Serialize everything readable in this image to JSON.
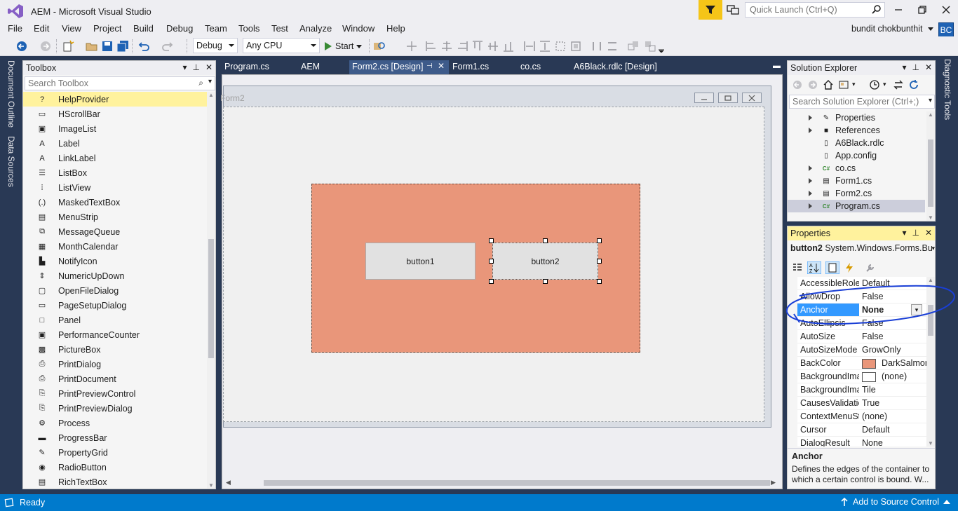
{
  "window": {
    "title": "AEM - Microsoft Visual Studio",
    "quick_launch_placeholder": "Quick Launch (Ctrl+Q)",
    "user_name": "bundit chokbunthit",
    "user_initials": "BC"
  },
  "menu": [
    "File",
    "Edit",
    "View",
    "Project",
    "Build",
    "Debug",
    "Team",
    "Tools",
    "Test",
    "Analyze",
    "Window",
    "Help"
  ],
  "toolbar": {
    "config": "Debug",
    "platform": "Any CPU",
    "start_label": "Start"
  },
  "left_tabs": [
    "Document Outline",
    "Data Sources"
  ],
  "right_tabs": [
    "Diagnostic Tools"
  ],
  "toolbox": {
    "title": "Toolbox",
    "search_placeholder": "Search Toolbox",
    "items": [
      {
        "label": "HelpProvider",
        "icon": "?",
        "selected": true
      },
      {
        "label": "HScrollBar",
        "icon": "▭"
      },
      {
        "label": "ImageList",
        "icon": "▣"
      },
      {
        "label": "Label",
        "icon": "A"
      },
      {
        "label": "LinkLabel",
        "icon": "A"
      },
      {
        "label": "ListBox",
        "icon": "☰"
      },
      {
        "label": "ListView",
        "icon": "⁞"
      },
      {
        "label": "MaskedTextBox",
        "icon": "(.)"
      },
      {
        "label": "MenuStrip",
        "icon": "▤"
      },
      {
        "label": "MessageQueue",
        "icon": "⧉"
      },
      {
        "label": "MonthCalendar",
        "icon": "▦"
      },
      {
        "label": "NotifyIcon",
        "icon": "▙"
      },
      {
        "label": "NumericUpDown",
        "icon": "⇕"
      },
      {
        "label": "OpenFileDialog",
        "icon": "▢"
      },
      {
        "label": "PageSetupDialog",
        "icon": "▭"
      },
      {
        "label": "Panel",
        "icon": "□"
      },
      {
        "label": "PerformanceCounter",
        "icon": "▣"
      },
      {
        "label": "PictureBox",
        "icon": "▩"
      },
      {
        "label": "PrintDialog",
        "icon": "⎙"
      },
      {
        "label": "PrintDocument",
        "icon": "⎙"
      },
      {
        "label": "PrintPreviewControl",
        "icon": "⎘"
      },
      {
        "label": "PrintPreviewDialog",
        "icon": "⎘"
      },
      {
        "label": "Process",
        "icon": "⚙"
      },
      {
        "label": "ProgressBar",
        "icon": "▬"
      },
      {
        "label": "PropertyGrid",
        "icon": "✎"
      },
      {
        "label": "RadioButton",
        "icon": "◉"
      },
      {
        "label": "RichTextBox",
        "icon": "▤"
      }
    ]
  },
  "doc_tabs": [
    {
      "label": "Program.cs"
    },
    {
      "label": "AEM"
    },
    {
      "label": "Form2.cs [Design]",
      "active": true
    },
    {
      "label": "Form1.cs"
    },
    {
      "label": "co.cs"
    },
    {
      "label": "A6Black.rdlc [Design]"
    }
  ],
  "designer": {
    "form_title": "Form2",
    "panel_color": "#E9967A",
    "button1": "button1",
    "button2": "button2"
  },
  "solution_explorer": {
    "title": "Solution Explorer",
    "search_placeholder": "Search Solution Explorer (Ctrl+;)",
    "items": [
      {
        "label": "Properties",
        "icon": "wrench",
        "expandable": true
      },
      {
        "label": "References",
        "icon": "refs",
        "expandable": true
      },
      {
        "label": "A6Black.rdlc",
        "icon": "doc",
        "expandable": false
      },
      {
        "label": "App.config",
        "icon": "doc",
        "expandable": false
      },
      {
        "label": "co.cs",
        "icon": "cs",
        "expandable": true
      },
      {
        "label": "Form1.cs",
        "icon": "form",
        "expandable": true
      },
      {
        "label": "Form2.cs",
        "icon": "form",
        "expandable": true
      },
      {
        "label": "Program.cs",
        "icon": "cs",
        "expandable": true,
        "selected": true
      }
    ]
  },
  "properties": {
    "title": "Properties",
    "object_name": "button2",
    "object_type": "System.Windows.Forms.Bu",
    "rows": [
      {
        "name": "AccessibleRole",
        "value": "Default"
      },
      {
        "name": "AllowDrop",
        "value": "False"
      },
      {
        "name": "Anchor",
        "value": "None",
        "selected": true
      },
      {
        "name": "AutoEllipsis",
        "value": "False"
      },
      {
        "name": "AutoSize",
        "value": "False"
      },
      {
        "name": "AutoSizeMode",
        "value": "GrowOnly"
      },
      {
        "name": "BackColor",
        "value": "DarkSalmon",
        "swatch": "#E9967A"
      },
      {
        "name": "BackgroundIma",
        "value": "(none)",
        "swatch": "#ffffff"
      },
      {
        "name": "BackgroundIma",
        "value": "Tile"
      },
      {
        "name": "CausesValidatio",
        "value": "True"
      },
      {
        "name": "ContextMenuSt",
        "value": "(none)"
      },
      {
        "name": "Cursor",
        "value": "Default"
      },
      {
        "name": "DialogResult",
        "value": "None"
      }
    ],
    "desc_title": "Anchor",
    "desc_text": "Defines the edges of the container to which a certain control is bound. W..."
  },
  "status": {
    "left": "Ready",
    "right": "Add to Source Control"
  },
  "colors": {
    "accent": "#007acc",
    "frame": "#293955",
    "selection_yellow": "#fff29d",
    "annotation": "#1a3fd6"
  }
}
